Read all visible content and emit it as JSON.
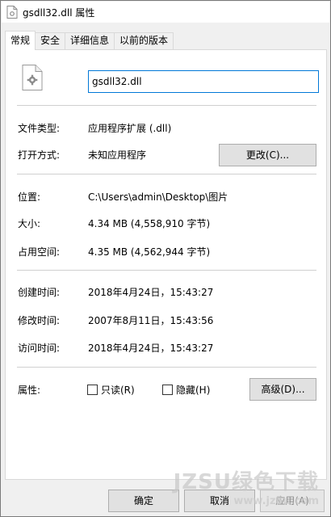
{
  "window": {
    "title": "gsdll32.dll 属性"
  },
  "tabs": [
    {
      "label": "常规",
      "active": true
    },
    {
      "label": "安全",
      "active": false
    },
    {
      "label": "详细信息",
      "active": false
    },
    {
      "label": "以前的版本",
      "active": false
    }
  ],
  "general": {
    "file_icon": "dll-gear-file-icon",
    "filename": "gsdll32.dll",
    "file_type_label": "文件类型:",
    "file_type_value": "应用程序扩展 (.dll)",
    "opens_with_label": "打开方式:",
    "opens_with_value": "未知应用程序",
    "change_button": "更改(C)...",
    "location_label": "位置:",
    "location_value": "C:\\Users\\admin\\Desktop\\图片",
    "size_label": "大小:",
    "size_value": "4.34 MB (4,558,910 字节)",
    "size_on_disk_label": "占用空间:",
    "size_on_disk_value": "4.35 MB (4,562,944 字节)",
    "created_label": "创建时间:",
    "created_value": "2018年4月24日，15:43:27",
    "modified_label": "修改时间:",
    "modified_value": "2007年8月11日，15:43:56",
    "accessed_label": "访问时间:",
    "accessed_value": "2018年4月24日，15:43:27",
    "attributes_label": "属性:",
    "readonly_label": "只读(R)",
    "hidden_label": "隐藏(H)",
    "advanced_button": "高级(D)..."
  },
  "footer": {
    "ok_button": "确定",
    "cancel_button": "取消",
    "apply_button": "应用(A)"
  },
  "watermark": {
    "main": "JZSU绿色下载",
    "sub": "www.jz5u.com"
  }
}
